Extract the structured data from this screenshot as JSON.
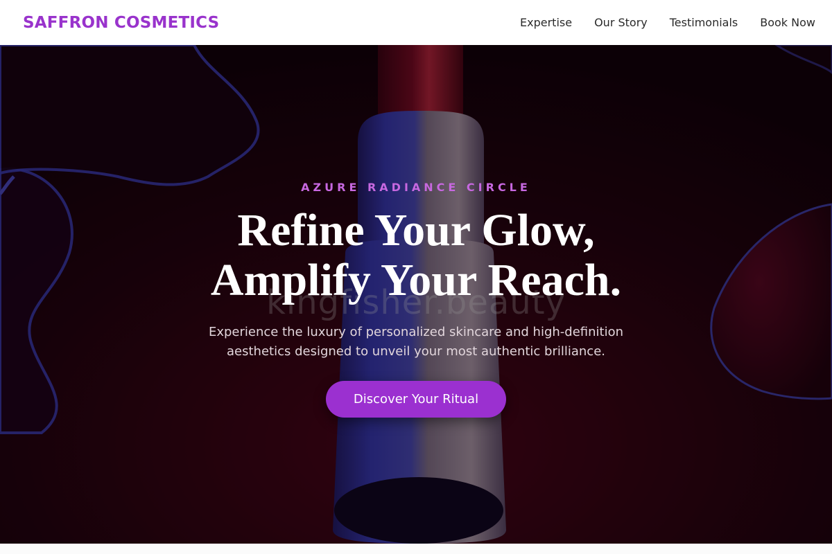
{
  "header": {
    "brand": "SAFFRON COSMETICS",
    "nav": [
      "Expertise",
      "Our Story",
      "Testimonials",
      "Book Now"
    ]
  },
  "hero": {
    "eyebrow": "AZURE RADIANCE CIRCLE",
    "headline_line1": "Refine Your Glow,",
    "headline_line2": "Amplify Your Reach.",
    "subtitle": "Experience the luxury of personalized skincare and high-definition aesthetics designed to unveil your most authentic brilliance.",
    "cta": "Discover Your Ritual",
    "watermark": "kingfisher.beauty"
  },
  "colors": {
    "brand": "#9933cc",
    "eyebrow": "#c768e0",
    "cta_bg": "#9b30d0"
  }
}
